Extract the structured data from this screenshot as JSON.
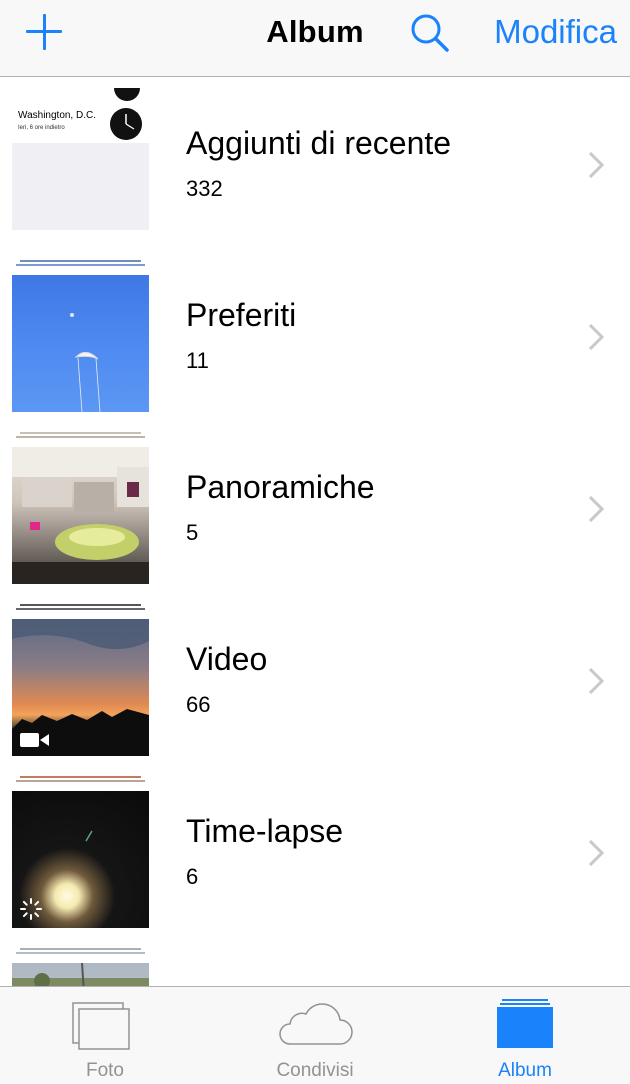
{
  "nav": {
    "title": "Album",
    "edit_label": "Modifica",
    "add_icon": "plus-icon",
    "search_icon": "search-icon"
  },
  "albums": [
    {
      "title": "Aggiunti di recente",
      "count": "332",
      "thumb": {
        "city": "Washington, D.C.",
        "sub": "Ieri, 6 ore indietro"
      }
    },
    {
      "title": "Preferiti",
      "count": "11"
    },
    {
      "title": "Panoramiche",
      "count": "5"
    },
    {
      "title": "Video",
      "count": "66"
    },
    {
      "title": "Time-lapse",
      "count": "6"
    }
  ],
  "tabbar": {
    "items": [
      {
        "label": "Foto",
        "icon": "photos-icon"
      },
      {
        "label": "Condivisi",
        "icon": "cloud-icon"
      },
      {
        "label": "Album",
        "icon": "albums-icon",
        "active": true
      }
    ]
  },
  "colors": {
    "accent": "#1a82fb",
    "inactive": "#929292",
    "bar": "#f8f8f8",
    "separator": "#b2b2b2"
  }
}
